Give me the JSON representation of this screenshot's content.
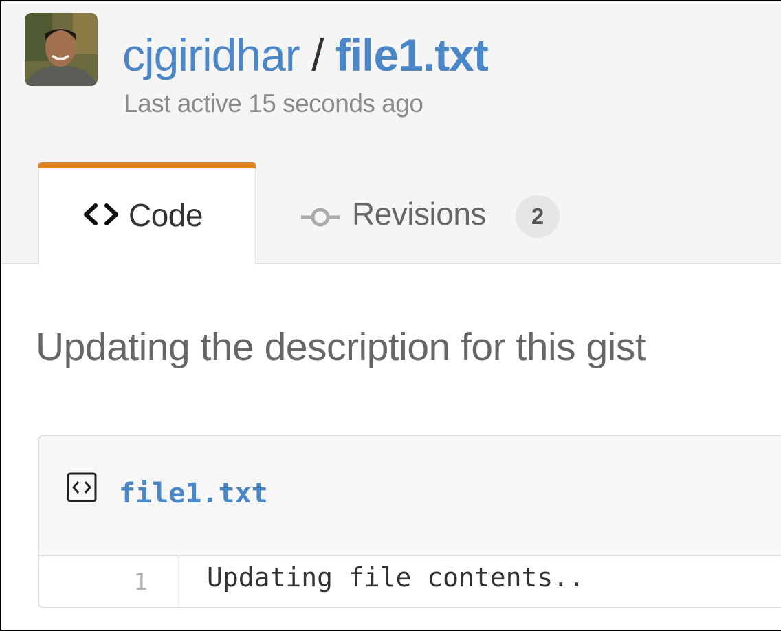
{
  "gist": {
    "owner": "cjgiridhar",
    "separator": " / ",
    "filename": "file1.txt",
    "last_active": "Last active 15 seconds ago"
  },
  "tabs": {
    "code": {
      "label": "Code",
      "icon": "code-icon"
    },
    "revisions": {
      "label": "Revisions",
      "icon": "commit-icon",
      "count": "2"
    }
  },
  "description": "Updating the description for this gist",
  "file": {
    "name": "file1.txt",
    "icon": "file-code-icon",
    "lines": [
      {
        "number": "1",
        "text": "Updating file contents.."
      }
    ]
  },
  "colors": {
    "link": "#4a86c8",
    "active_tab_accent": "#e08323",
    "muted_text": "#8a8a8a"
  }
}
